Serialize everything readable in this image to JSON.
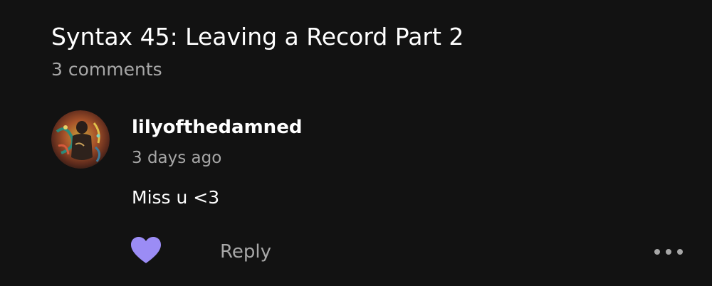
{
  "header": {
    "title": "Syntax 45: Leaving a Record Part 2",
    "comment_count": "3 comments"
  },
  "comment": {
    "author": "lilyofthedamned",
    "time": "3 days ago",
    "text": "Miss u <3",
    "avatar_icon": "user-avatar"
  },
  "actions": {
    "like_icon": "heart-icon",
    "like_color": "#9b8cf5",
    "reply_label": "Reply",
    "more_icon": "more-options-icon"
  }
}
